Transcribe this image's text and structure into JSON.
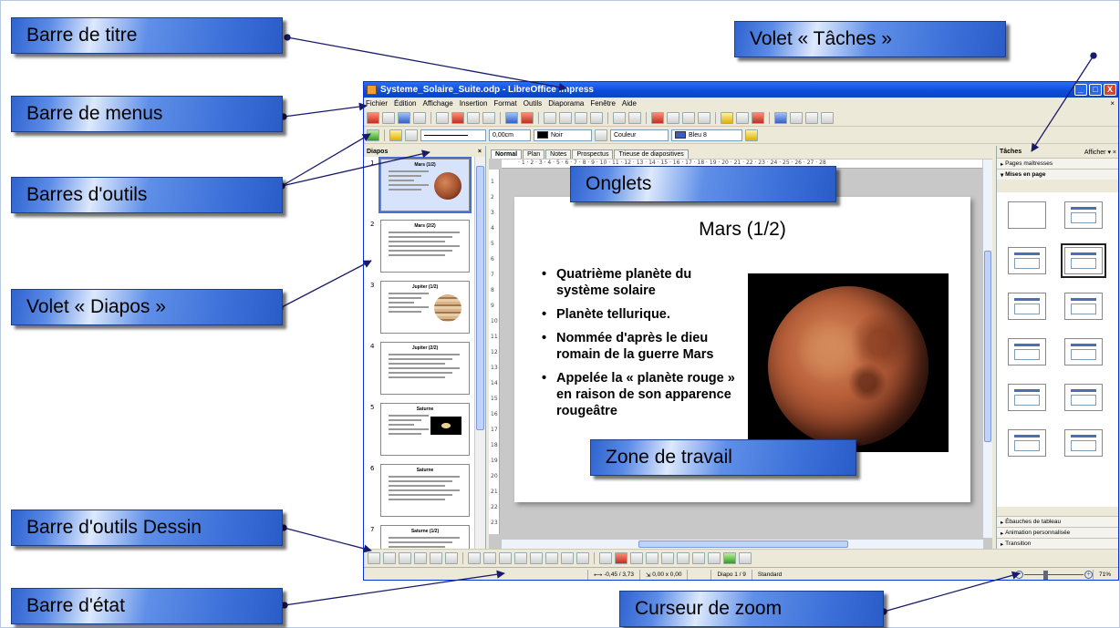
{
  "annotations": {
    "titlebar": "Barre de titre",
    "menubar": "Barre de menus",
    "toolbars": "Barres d'outils",
    "slides_pane": "Volet « Diapos »",
    "drawing_bar": "Barre d'outils Dessin",
    "statusbar": "Barre d'état",
    "tasks_pane": "Volet « Tâches »",
    "tabs": "Onglets",
    "workspace": "Zone de travail",
    "zoom": "Curseur de zoom"
  },
  "window": {
    "title": "Systeme_Solaire_Suite.odp - LibreOffice Impress",
    "minimize": "_",
    "maximize": "□",
    "close": "X"
  },
  "menu": [
    "Fichier",
    "Édition",
    "Affichage",
    "Insertion",
    "Format",
    "Outils",
    "Diaporama",
    "Fenêtre",
    "Aide"
  ],
  "menu_close": "×",
  "line_toolbar": {
    "width_value": "0,00cm",
    "line_color": "Noir",
    "area_style": "Couleur",
    "area_color": "Bleu 8",
    "line_color_hex": "#000000",
    "area_color_hex": "#3b5bbf"
  },
  "slides_pane": {
    "title": "Diapos",
    "close": "×",
    "thumbnails": [
      {
        "num": "1",
        "title": "Mars (1/2)",
        "img": "mars"
      },
      {
        "num": "2",
        "title": "Mars (2/2)",
        "img": ""
      },
      {
        "num": "3",
        "title": "Jupiter (1/2)",
        "img": "jupiter"
      },
      {
        "num": "4",
        "title": "Jupiter (2/2)",
        "img": ""
      },
      {
        "num": "5",
        "title": "Saturne",
        "img": "saturn"
      },
      {
        "num": "6",
        "title": "Saturne",
        "img": ""
      },
      {
        "num": "7",
        "title": "Saturne (1/2)",
        "img": ""
      }
    ]
  },
  "tabs": [
    "Normal",
    "Plan",
    "Notes",
    "Prospectus",
    "Trieuse de diapositives"
  ],
  "ruler": {
    "h": "· 1 · 2 · 3 · 4 · 5 · 6 · 7 · 8 · 9 · 10 · 11 · 12 · 13 · 14 · 15 · 16 · 17 · 18 · 19 · 20 · 21 · 22 · 23 · 24 · 25 · 26 · 27 · 28",
    "v": [
      "1",
      "2",
      "3",
      "4",
      "5",
      "6",
      "7",
      "8",
      "9",
      "10",
      "11",
      "12",
      "13",
      "14",
      "15",
      "16",
      "17",
      "18",
      "19",
      "20",
      "21",
      "22",
      "23"
    ]
  },
  "slide": {
    "title": "Mars (1/2)",
    "bullets": [
      "Quatrième planète du système solaire",
      "Planète tellurique.",
      "Nommée d'après le dieu romain de la guerre Mars",
      "Appelée la « planète rouge » en raison de son apparence rougeâtre"
    ]
  },
  "tasks_pane": {
    "title": "Tâches",
    "view_menu": "Afficher ▾ ×",
    "sections_top": [
      "Pages maîtresses",
      "Mises en page"
    ],
    "sections_bottom": [
      "Ébauches de tableau",
      "Animation personnalisée",
      "Transition"
    ]
  },
  "statusbar": {
    "position": "-0,45 / 3,73",
    "size": "0,00 x 0,00",
    "slide": "Diapo 1 / 9",
    "master": "Standard",
    "zoom": "71%",
    "zoom_fraction": 0.35
  },
  "colors": {
    "callout_border": "#1d3f8a",
    "arrow": "#1a1a6a",
    "titlebar": "#0a4bd8"
  }
}
